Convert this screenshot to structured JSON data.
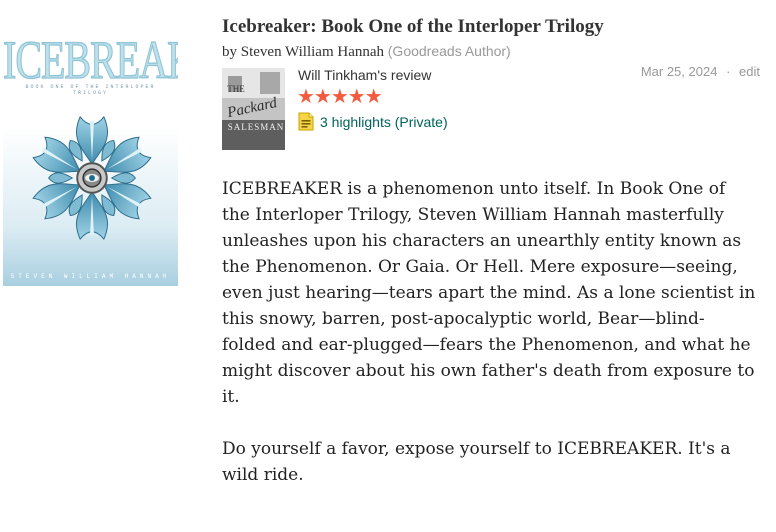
{
  "book": {
    "title": "Icebreaker: Book One of the Interloper Trilogy",
    "by_label": "by",
    "author": "Steven William Hannah",
    "author_badge": "(Goodreads Author)",
    "cover": {
      "title": "ICEBREAKER",
      "series": "BOOK ONE OF THE INTERLOPER TRILOGY",
      "author": "STEVEN WILLIAM HANNAH"
    }
  },
  "review": {
    "reviewer_name": "Will Tinkham",
    "review_label": "'s review",
    "avatar_text": "The Packard Salesman",
    "rating": 5,
    "stars": "★★★★★",
    "highlights": "3 highlights (Private)",
    "date": "Mar 25, 2024",
    "separator": "·",
    "edit": "edit",
    "paragraphs": [
      "ICEBREAKER is a phenomenon unto itself. In Book One of the Interloper Trilogy, Steven William Hannah masterfully unleashes upon his characters an unearthly entity known as the Phenomenon. Or Gaia. Or Hell. Mere exposure—seeing, even just hearing—tears apart the mind. As a lone scientist in this snowy, barren, post-apocalyptic world, Bear—blind-folded and ear-plugged—fears the Phenomenon, and what he might discover about his own father's death from exposure to it.",
      "Do yourself a favor, expose yourself to ICEBREAKER. It's a wild ride."
    ]
  },
  "colors": {
    "star": "#f25b3e",
    "link_green": "#00635d",
    "muted": "#999999",
    "highlight_icon": "#f5d547"
  },
  "icons": {
    "highlight": "highlight-note-icon",
    "star": "star-icon"
  }
}
